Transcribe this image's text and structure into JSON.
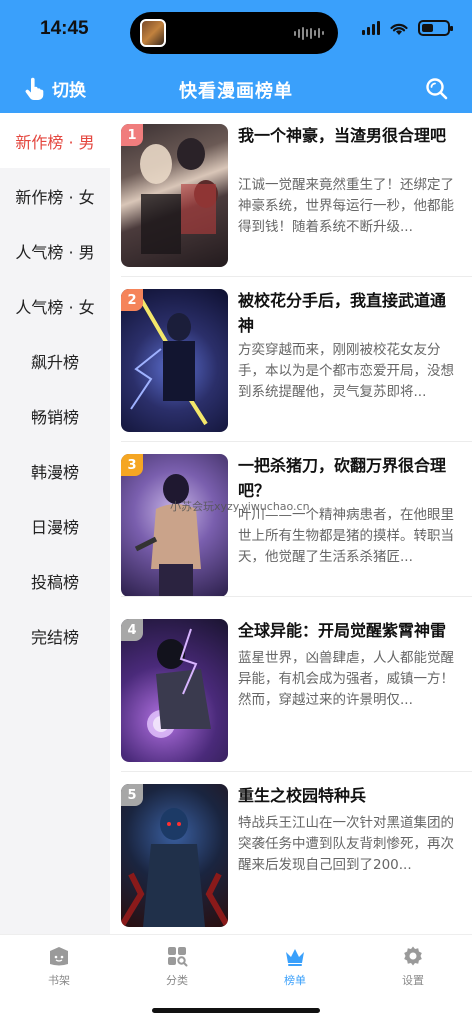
{
  "status_bar": {
    "time": "14:45"
  },
  "header": {
    "switch_label": "切换",
    "title": "快看漫画榜单",
    "icons": {
      "switch": "hand-pointer-icon",
      "search": "search-icon"
    }
  },
  "sidebar": {
    "items": [
      {
        "label": "新作榜 · 男",
        "active": true
      },
      {
        "label": "新作榜 · 女",
        "active": false
      },
      {
        "label": "人气榜 · 男",
        "active": false
      },
      {
        "label": "人气榜 · 女",
        "active": false
      },
      {
        "label": "飙升榜",
        "active": false
      },
      {
        "label": "畅销榜",
        "active": false
      },
      {
        "label": "韩漫榜",
        "active": false
      },
      {
        "label": "日漫榜",
        "active": false
      },
      {
        "label": "投稿榜",
        "active": false
      },
      {
        "label": "完结榜",
        "active": false
      }
    ]
  },
  "list": {
    "items": [
      {
        "rank": "1",
        "title": "我一个神豪，当渣男很合理吧",
        "desc": "江诚一觉醒来竟然重生了！还绑定了神豪系统，世界每运行一秒，他都能得到钱！随着系统不断升级..."
      },
      {
        "rank": "2",
        "title": "被校花分手后，我直接武道通神",
        "desc": "方奕穿越而来，刚刚被校花女友分手，本以为是个都市恋爱开局，没想到系统提醒他，灵气复苏即将..."
      },
      {
        "rank": "3",
        "title": "一把杀猪刀，砍翻万界很合理吧？",
        "desc": "叶川——一个精神病患者，在他眼里世上所有生物都是猪的摸样。转职当天，他觉醒了生活系杀猪匠..."
      },
      {
        "rank": "4",
        "title": "全球异能：开局觉醒紫霄神雷",
        "desc": "蓝星世界，凶兽肆虐，人人都能觉醒异能，有机会成为强者，威镇一方！然而，穿越过来的许景明仅..."
      },
      {
        "rank": "5",
        "title": "重生之校园特种兵",
        "desc": "特战兵王江山在一次针对黑道集团的突袭任务中遭到队友背刺惨死，再次醒来后发现自己回到了200..."
      }
    ],
    "rank_colors": [
      "#f07d7d",
      "#f5845a",
      "#f5a623",
      "#a7a7a7",
      "#a7a7a7"
    ]
  },
  "watermark": "小苏会玩xyzy.yiwuchao.cn",
  "tabbar": {
    "tabs": [
      {
        "label": "书架",
        "icon": "bookshelf-icon",
        "active": false
      },
      {
        "label": "分类",
        "icon": "category-icon",
        "active": false
      },
      {
        "label": "榜单",
        "icon": "crown-icon",
        "active": true
      },
      {
        "label": "设置",
        "icon": "gear-icon",
        "active": false
      }
    ]
  },
  "colors": {
    "accent": "#3aa0fb",
    "active_text": "#e4473f"
  }
}
